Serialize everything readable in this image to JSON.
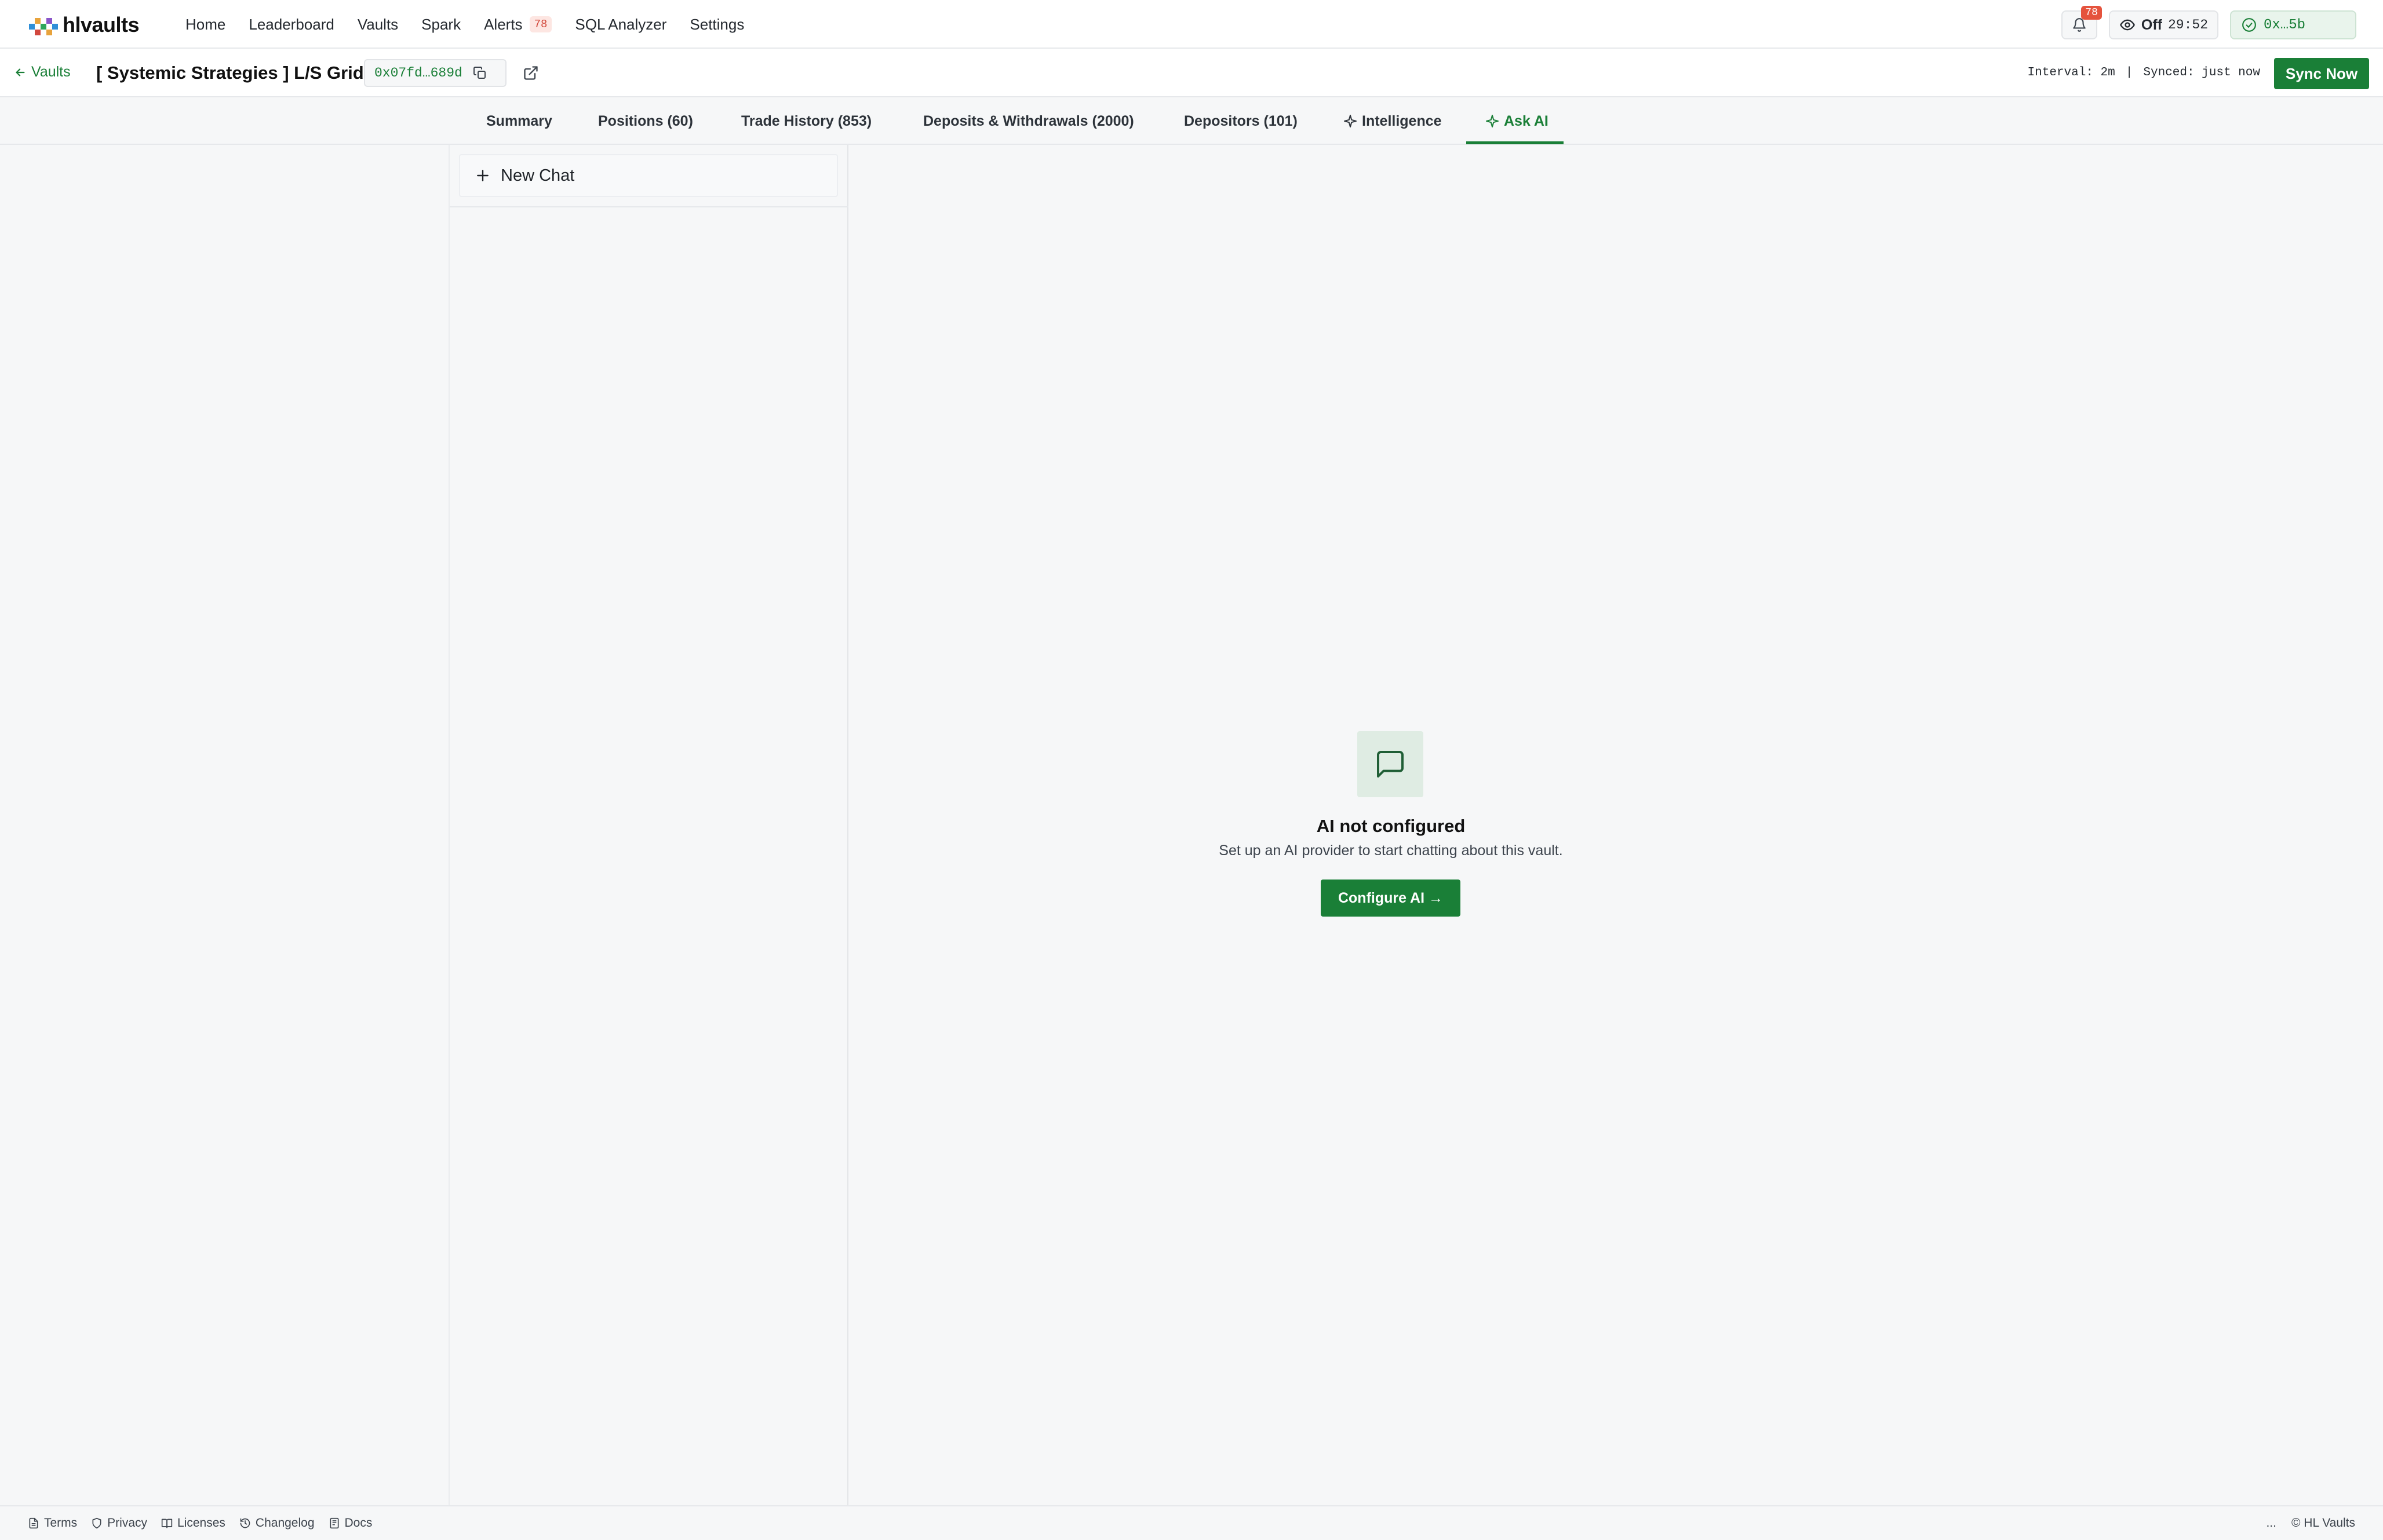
{
  "app": {
    "logo_text": "hlvaults"
  },
  "nav": {
    "items": [
      {
        "label": "Home"
      },
      {
        "label": "Leaderboard"
      },
      {
        "label": "Vaults"
      },
      {
        "label": "Spark"
      },
      {
        "label": "Alerts",
        "badge": "78"
      },
      {
        "label": "SQL Analyzer"
      },
      {
        "label": "Settings"
      }
    ]
  },
  "top_right": {
    "notification_count": "78",
    "watch_status": "Off",
    "watch_timer": "29:52",
    "wallet_address": "0x…5b"
  },
  "vault": {
    "back_label": "Vaults",
    "title": "[ Systemic Strategies ] L/S Grids",
    "address": "0x07fd…689d",
    "interval": "Interval: 2m",
    "separator": "|",
    "synced": "Synced: just now",
    "sync_button": "Sync Now"
  },
  "tabs": [
    {
      "label": "Summary",
      "active": false
    },
    {
      "label": "Positions (60)",
      "active": false
    },
    {
      "label": "Trade History (853)",
      "active": false
    },
    {
      "label": "Deposits & Withdrawals (2000)",
      "active": false
    },
    {
      "label": "Depositors (101)",
      "active": false
    },
    {
      "label": "Intelligence",
      "active": false,
      "icon": "sparkle-icon"
    },
    {
      "label": "Ask AI",
      "active": true,
      "icon": "sparkle-icon"
    }
  ],
  "chat": {
    "new_chat_label": "New Chat"
  },
  "empty_state": {
    "icon": "message-square-icon",
    "title": "AI not configured",
    "subtitle": "Set up an AI provider to start chatting about this vault.",
    "button": "Configure AI →"
  },
  "footer": {
    "links": [
      {
        "label": "Terms",
        "icon": "file-icon"
      },
      {
        "label": "Privacy",
        "icon": "shield-icon"
      },
      {
        "label": "Licenses",
        "icon": "book-icon"
      },
      {
        "label": "Changelog",
        "icon": "history-icon"
      },
      {
        "label": "Docs",
        "icon": "doc-icon"
      }
    ],
    "ellipsis": "...",
    "copyright": "© HL Vaults"
  },
  "colors": {
    "accent": "#1a7f37",
    "badge": "#e5533d",
    "background": "#f6f7f8"
  }
}
